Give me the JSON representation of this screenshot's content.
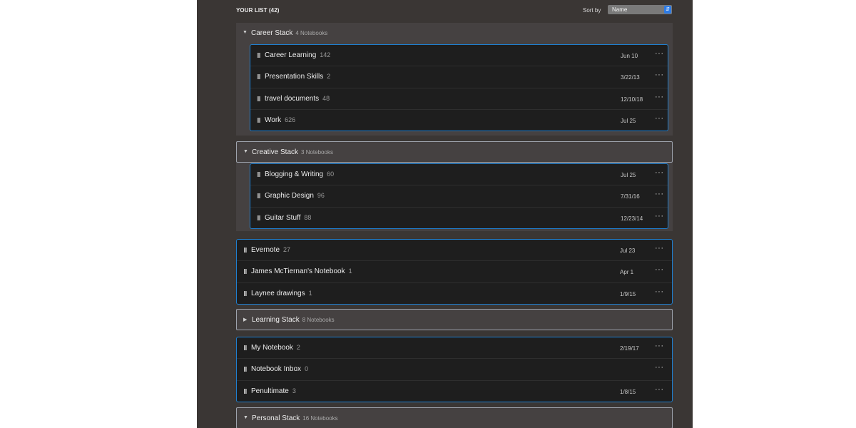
{
  "header": {
    "list_title": "YOUR LIST (42)",
    "sort_label": "Sort by",
    "sort_value": "Name"
  },
  "stacks": {
    "career": {
      "name": "Career Stack",
      "count": "4 Notebooks",
      "notebooks": [
        {
          "name": "Career Learning",
          "count": "142",
          "date": "Jun 10"
        },
        {
          "name": "Presentation Skills",
          "count": "2",
          "date": "3/22/13"
        },
        {
          "name": "travel documents",
          "count": "48",
          "date": "12/10/18"
        },
        {
          "name": "Work",
          "count": "626",
          "date": "Jul 25"
        }
      ]
    },
    "creative": {
      "name": "Creative Stack",
      "count": "3 Notebooks",
      "notebooks": [
        {
          "name": "Blogging & Writing",
          "count": "60",
          "date": "Jul 25"
        },
        {
          "name": "Graphic Design",
          "count": "96",
          "date": "7/31/16"
        },
        {
          "name": "Guitar Stuff",
          "count": "88",
          "date": "12/23/14"
        }
      ]
    },
    "learning": {
      "name": "Learning Stack",
      "count": "8 Notebooks"
    },
    "personal": {
      "name": "Personal Stack",
      "count": "16 Notebooks"
    }
  },
  "loose_group_1": [
    {
      "name": "Evernote",
      "count": "27",
      "date": "Jul 23"
    },
    {
      "name": "James McTiernan's Notebook",
      "count": "1",
      "date": "Apr 1"
    },
    {
      "name": "Laynee drawings",
      "count": "1",
      "date": "1/9/15"
    }
  ],
  "loose_group_2": [
    {
      "name": "My Notebook",
      "count": "2",
      "date": "2/19/17"
    },
    {
      "name": "Notebook Inbox",
      "count": "0",
      "date": ""
    },
    {
      "name": "Penultimate",
      "count": "3",
      "date": "1/8/15"
    }
  ],
  "more_glyph": "···",
  "colors": {
    "panel_bg": "#3a3634",
    "stack_bg": "#454141",
    "group_bg": "#1e1e1e",
    "selection": "#1f7fd0",
    "sort_accent": "#2d7be5"
  },
  "icons": {
    "expanded": "chevron-down-icon",
    "collapsed": "chevron-right-icon",
    "notebook": "notebook-icon",
    "more": "more-options-icon"
  }
}
